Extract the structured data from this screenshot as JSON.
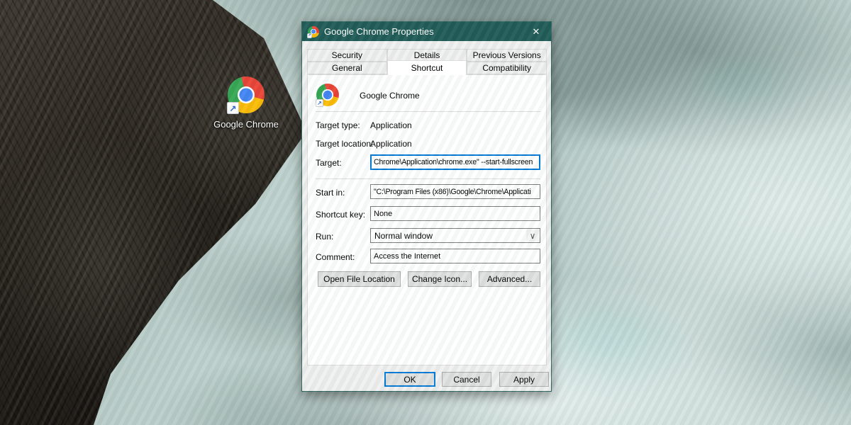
{
  "desktop": {
    "chrome_icon_label": "Google Chrome"
  },
  "dialog": {
    "title": "Google Chrome Properties",
    "tabs": {
      "back": [
        "Security",
        "Details",
        "Previous Versions"
      ],
      "front": [
        "General",
        "Shortcut",
        "Compatibility"
      ],
      "active": "Shortcut"
    },
    "app_name": "Google Chrome",
    "rows": {
      "target_type": {
        "label": "Target type:",
        "value": "Application"
      },
      "target_location": {
        "label": "Target location:",
        "value": "Application"
      },
      "target": {
        "label": "Target:",
        "value": "Chrome\\Application\\chrome.exe\" --start-fullscreen"
      },
      "start_in": {
        "label": "Start in:",
        "value": "\"C:\\Program Files (x86)\\Google\\Chrome\\Applicati"
      },
      "shortcut_key": {
        "label": "Shortcut key:",
        "value": "None"
      },
      "run": {
        "label": "Run:",
        "value": "Normal window"
      },
      "comment": {
        "label": "Comment:",
        "value": "Access the Internet"
      }
    },
    "action_buttons": {
      "open_file_location": "Open File Location",
      "change_icon": "Change Icon...",
      "advanced": "Advanced..."
    },
    "footer_buttons": {
      "ok": "OK",
      "cancel": "Cancel",
      "apply": "Apply"
    }
  },
  "icons": {
    "close": "✕",
    "shortcut_arrow": "↗",
    "dropdown_chevron": "∨"
  },
  "colors": {
    "titlebar": "#1f5b56",
    "focus_blue": "#0078d7",
    "chrome_red": "#ea4335",
    "chrome_yellow": "#fbbc05",
    "chrome_green": "#34a853",
    "chrome_blue": "#4285f4"
  }
}
